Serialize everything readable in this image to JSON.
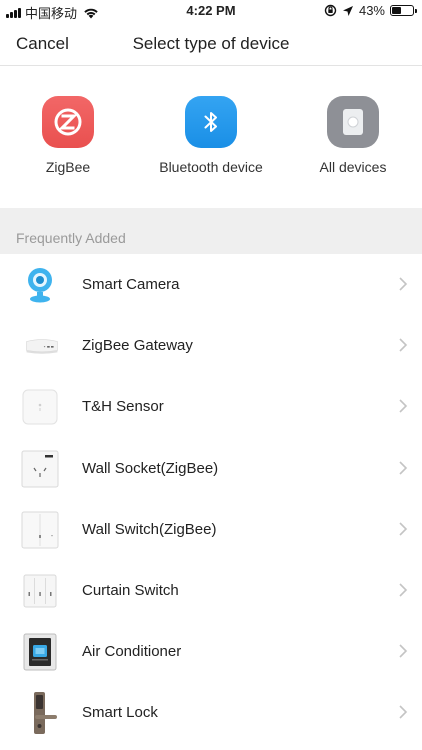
{
  "status_bar": {
    "carrier": "中国移动",
    "time": "4:22 PM",
    "battery": "43%",
    "battery_level": 0.43
  },
  "header": {
    "cancel_label": "Cancel",
    "title": "Select type of device"
  },
  "device_types": [
    {
      "label": "ZigBee",
      "icon": "zigbee-icon",
      "color": "#ec5857"
    },
    {
      "label": "Bluetooth device",
      "icon": "bluetooth-icon",
      "color": "#2599ec"
    },
    {
      "label": "All devices",
      "icon": "all-devices-icon",
      "color": "#8e9096"
    }
  ],
  "section": {
    "title": "Frequently Added"
  },
  "devices": [
    {
      "label": "Smart Camera",
      "icon": "smart-camera-icon"
    },
    {
      "label": "ZigBee Gateway",
      "icon": "zigbee-gateway-icon"
    },
    {
      "label": "T&H Sensor",
      "icon": "th-sensor-icon"
    },
    {
      "label": "Wall Socket(ZigBee)",
      "icon": "wall-socket-icon"
    },
    {
      "label": "Wall Switch(ZigBee)",
      "icon": "wall-switch-icon"
    },
    {
      "label": "Curtain Switch",
      "icon": "curtain-switch-icon"
    },
    {
      "label": "Air Conditioner",
      "icon": "air-conditioner-icon"
    },
    {
      "label": "Smart Lock",
      "icon": "smart-lock-icon"
    }
  ]
}
